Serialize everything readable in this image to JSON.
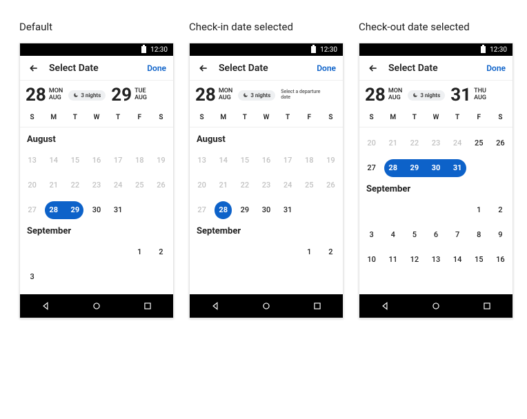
{
  "captions": {
    "default": "Default",
    "checkin": "Check-in date selected",
    "checkout": "Check-out date selected"
  },
  "statusbar": {
    "time": "12:30"
  },
  "appbar": {
    "title": "Select Date",
    "done": "Done"
  },
  "dow": [
    "S",
    "M",
    "T",
    "W",
    "T",
    "F",
    "S"
  ],
  "months": {
    "aug": "August",
    "sep": "September"
  },
  "chip_nights": "3 nights",
  "prompt_departure": "Select a departure date",
  "screens": {
    "default": {
      "checkin": {
        "day": "28",
        "dow": "MON",
        "mon": "AUG"
      },
      "checkout": {
        "day": "29",
        "dow": "TUE",
        "mon": "AUG"
      },
      "aug_past": [
        "13",
        "14",
        "15",
        "16",
        "17",
        "18",
        "19",
        "20",
        "21",
        "22",
        "23",
        "24",
        "25",
        "26",
        "27"
      ],
      "aug_sel_start": "28",
      "aug_sel_end": "29",
      "aug_future": [
        "30",
        "31"
      ],
      "sep_row1": [
        "1",
        "2"
      ],
      "sep_row2": [
        "3"
      ]
    },
    "checkin": {
      "checkin": {
        "day": "28",
        "dow": "MON",
        "mon": "AUG"
      },
      "aug_past": [
        "13",
        "14",
        "15",
        "16",
        "17",
        "18",
        "19",
        "20",
        "21",
        "22",
        "23",
        "24",
        "25",
        "26",
        "27"
      ],
      "aug_sel_single": "28",
      "aug_future": [
        "29",
        "30",
        "31"
      ],
      "sep_row1": [
        "1",
        "2"
      ]
    },
    "checkout": {
      "checkin": {
        "day": "28",
        "dow": "MON",
        "mon": "AUG"
      },
      "checkout": {
        "day": "31",
        "dow": "THU",
        "mon": "AUG"
      },
      "aug_past_row0": [
        "20",
        "21",
        "22",
        "23",
        "24"
      ],
      "aug_fut_row0": [
        "25",
        "26"
      ],
      "aug_row1_pre": "27",
      "aug_sel": [
        "28",
        "29",
        "30",
        "31"
      ],
      "sep_row0": [
        "1",
        "2"
      ],
      "sep_row1": [
        "3",
        "4",
        "5",
        "6",
        "7",
        "8",
        "9"
      ],
      "sep_row2": [
        "10",
        "11",
        "12",
        "13",
        "14",
        "15",
        "16"
      ]
    }
  }
}
